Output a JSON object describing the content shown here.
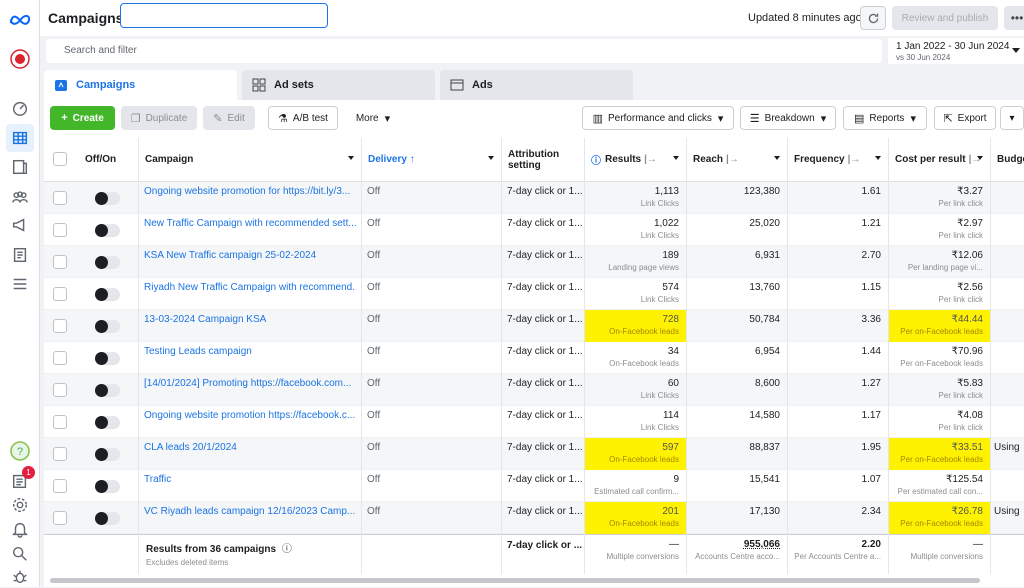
{
  "app": {
    "title": "Campaigns",
    "updated": "Updated 8 minutes ago",
    "review_label": "Review and publish",
    "more_label": "•••"
  },
  "search": {
    "placeholder": "Search and filter"
  },
  "date_range": {
    "main": "1 Jan 2022 - 30 Jun 2024",
    "compare": "vs 30 Jun 2024"
  },
  "tabs": [
    {
      "label": "Campaigns"
    },
    {
      "label": "Ad sets"
    },
    {
      "label": "Ads"
    }
  ],
  "toolbar": {
    "create": "Create",
    "duplicate": "Duplicate",
    "edit": "Edit",
    "ab_test": "A/B test",
    "more": "More",
    "columns": "Performance and clicks",
    "breakdown": "Breakdown",
    "reports": "Reports",
    "export": "Export"
  },
  "headers": {
    "onoff": "Off/On",
    "campaign": "Campaign",
    "delivery": "Delivery ↑",
    "attribution": "Attribution setting",
    "results": "Results",
    "reach": "Reach",
    "frequency": "Frequency",
    "cpr": "Cost per result",
    "budget": "Budge"
  },
  "rows": [
    {
      "campaign": "Ongoing website promotion for https://bit.ly/3...",
      "delivery": "Off",
      "attribution": "7-day click or 1...",
      "results": "1,113",
      "results_sub": "Link Clicks",
      "reach": "123,380",
      "frequency": "1.61",
      "cpr": "₹3.27",
      "cpr_sub": "Per link click",
      "budget": "",
      "highlight": false
    },
    {
      "campaign": "New Traffic Campaign with recommended sett...",
      "delivery": "Off",
      "attribution": "7-day click or 1...",
      "results": "1,022",
      "results_sub": "Link Clicks",
      "reach": "25,020",
      "frequency": "1.21",
      "cpr": "₹2.97",
      "cpr_sub": "Per link click",
      "budget": "",
      "highlight": false
    },
    {
      "campaign": "KSA New Traffic campaign 25-02-2024",
      "delivery": "Off",
      "attribution": "7-day click or 1...",
      "results": "189",
      "results_sub": "Landing page views",
      "reach": "6,931",
      "frequency": "2.70",
      "cpr": "₹12.06",
      "cpr_sub": "Per landing page vi...",
      "budget": "",
      "highlight": false
    },
    {
      "campaign": "Riyadh New Traffic Campaign with recommend...",
      "delivery": "Off",
      "attribution": "7-day click or 1...",
      "results": "574",
      "results_sub": "Link Clicks",
      "reach": "13,760",
      "frequency": "1.15",
      "cpr": "₹2.56",
      "cpr_sub": "Per link click",
      "budget": "",
      "highlight": false
    },
    {
      "campaign": "13-03-2024 Campaign KSA",
      "delivery": "Off",
      "attribution": "7-day click or 1...",
      "results": "728",
      "results_sub": "On-Facebook leads",
      "reach": "50,784",
      "frequency": "3.36",
      "cpr": "₹44.44",
      "cpr_sub": "Per on-Facebook leads",
      "budget": "",
      "highlight": true
    },
    {
      "campaign": "Testing Leads campaign",
      "delivery": "Off",
      "attribution": "7-day click or 1...",
      "results": "34",
      "results_sub": "On-Facebook leads",
      "reach": "6,954",
      "frequency": "1.44",
      "cpr": "₹70.96",
      "cpr_sub": "Per on-Facebook leads",
      "budget": "",
      "highlight": false
    },
    {
      "campaign": "[14/01/2024] Promoting https://facebook.com...",
      "delivery": "Off",
      "attribution": "7-day click or 1...",
      "results": "60",
      "results_sub": "Link Clicks",
      "reach": "8,600",
      "frequency": "1.27",
      "cpr": "₹5.83",
      "cpr_sub": "Per link click",
      "budget": "",
      "highlight": false
    },
    {
      "campaign": "Ongoing website promotion https://facebook.c...",
      "delivery": "Off",
      "attribution": "7-day click or 1...",
      "results": "114",
      "results_sub": "Link Clicks",
      "reach": "14,580",
      "frequency": "1.17",
      "cpr": "₹4.08",
      "cpr_sub": "Per link click",
      "budget": "",
      "highlight": false
    },
    {
      "campaign": "CLA leads 20/1/2024",
      "delivery": "Off",
      "attribution": "7-day click or 1...",
      "results": "597",
      "results_sub": "On-Facebook leads",
      "reach": "88,837",
      "frequency": "1.95",
      "cpr": "₹33.51",
      "cpr_sub": "Per on-Facebook leads",
      "budget": "Using",
      "highlight": true
    },
    {
      "campaign": "Traffic",
      "delivery": "Off",
      "attribution": "7-day click or 1...",
      "results": "9",
      "results_sub": "Estimated call confirm...",
      "reach": "15,541",
      "frequency": "1.07",
      "cpr": "₹125.54",
      "cpr_sub": "Per estimated call con...",
      "budget": "",
      "highlight": false
    },
    {
      "campaign": "VC Riyadh leads campaign 12/16/2023 Camp...",
      "delivery": "Off",
      "attribution": "7-day click or 1...",
      "results": "201",
      "results_sub": "On-Facebook leads",
      "reach": "17,130",
      "frequency": "2.34",
      "cpr": "₹26.78",
      "cpr_sub": "Per on-Facebook leads",
      "budget": "Using",
      "highlight": true
    }
  ],
  "footer": {
    "title": "Results from 36 campaigns",
    "sub": "Excludes deleted items",
    "attribution": "7-day click or ...",
    "results": "—",
    "results_sub": "Multiple conversions",
    "reach": "955,066",
    "reach_sub": "Accounts Centre acco...",
    "frequency": "2.20",
    "frequency_sub": "Per Accounts Centre a...",
    "cpr": "—",
    "cpr_sub": "Multiple conversions"
  },
  "notifications_badge": "1",
  "colors": {
    "accent": "#1b74e4",
    "create": "#42b72a",
    "highlight": "#fff200"
  }
}
